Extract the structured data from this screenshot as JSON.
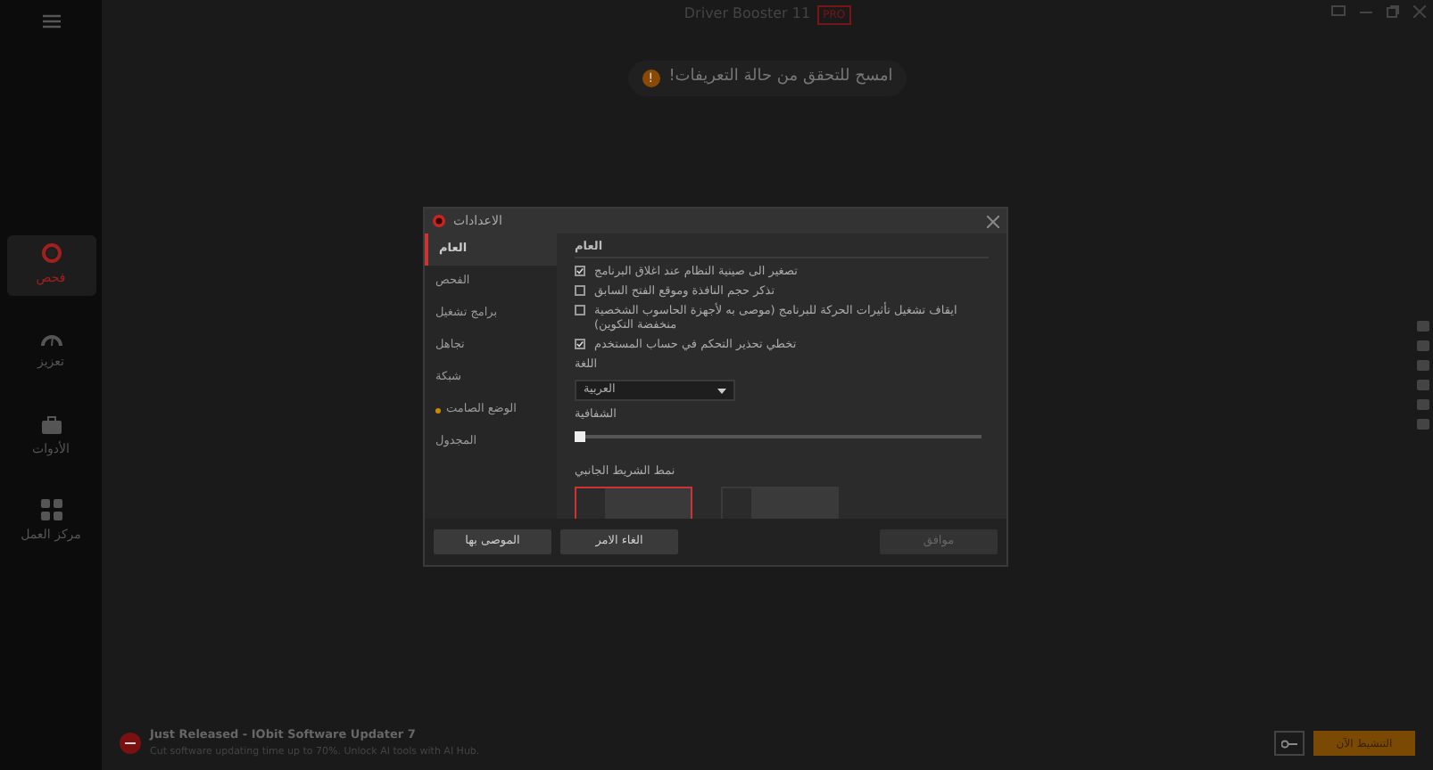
{
  "window": {
    "title": "Driver Booster 11",
    "badge": "PRO"
  },
  "sidebar": {
    "items": [
      {
        "label": "فحص",
        "selected": true,
        "kind": "scan"
      },
      {
        "label": "تعزيز",
        "selected": false,
        "kind": "boost"
      },
      {
        "label": "الأدوات",
        "selected": false,
        "kind": "tools"
      },
      {
        "label": "مركز العمل",
        "selected": false,
        "kind": "grid"
      }
    ]
  },
  "hint": {
    "icon": "!",
    "text": "امسح للتحقق من حالة التعريفات!"
  },
  "dialog": {
    "title": "الاعدادات",
    "nav": [
      {
        "label": "العام",
        "selected": true,
        "dot": false
      },
      {
        "label": "الفحص",
        "selected": false,
        "dot": false
      },
      {
        "label": "برامج تشغيل",
        "selected": false,
        "dot": false
      },
      {
        "label": "تجاهل",
        "selected": false,
        "dot": false
      },
      {
        "label": "شبكة",
        "selected": false,
        "dot": false
      },
      {
        "label": "الوضع الصامت",
        "selected": false,
        "dot": true
      },
      {
        "label": "المجدول",
        "selected": false,
        "dot": false
      }
    ],
    "section": "العام",
    "options": [
      {
        "label": "تصغير الى صينية النظام عند اغلاق البرنامج",
        "checked": true
      },
      {
        "label": "تذكر حجم النافذة وموقع الفتح السابق",
        "checked": false
      },
      {
        "label": "ايقاف تشغيل تأثيرات الحركة للبرنامج (موصى به لأجهزة الحاسوب الشخصية منخفضة التكوين)",
        "checked": false
      },
      {
        "label": "تخطي تحذير التحكم في حساب المستخدم",
        "checked": true
      }
    ],
    "language_label": "اللغة",
    "language": "العربية",
    "transparency_label": "الشفافية",
    "transparency": {
      "level": 0.0
    },
    "sidebar_style_label": "نمط الشريط الجانبي",
    "sidebar_styles": [
      {
        "selected": true
      },
      {
        "selected": false
      }
    ],
    "buttons": [
      {
        "label": "موافق",
        "disabled": true
      },
      {
        "label": "الغاء الامر",
        "disabled": false
      },
      {
        "label": "الموصى بها",
        "disabled": false
      }
    ]
  },
  "promo": {
    "title": "Just Released - IObit Software Updater 7",
    "text": "Cut software updating time up to 70%. Unlock AI tools with AI Hub."
  },
  "activate": "التنشيط الآن"
}
